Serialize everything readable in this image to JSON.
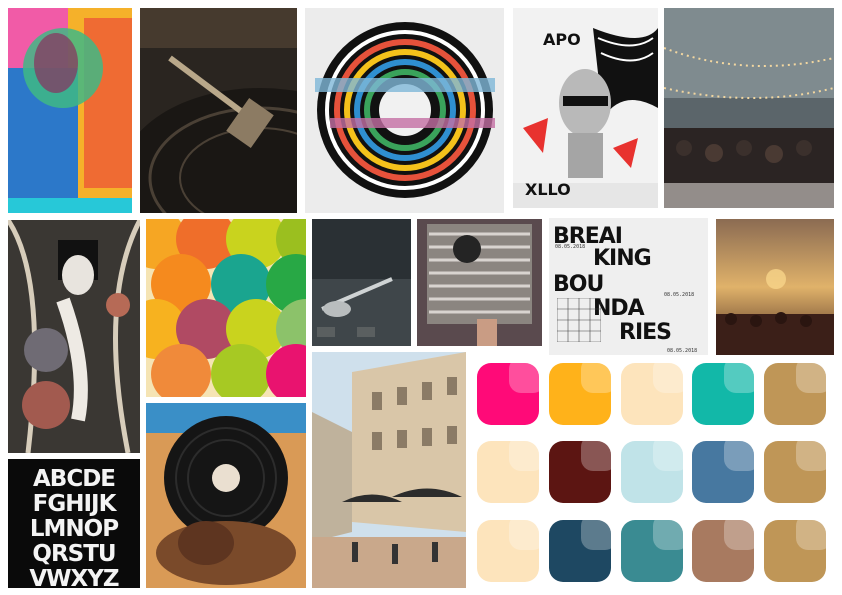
{
  "moodboard": {
    "alphabet_lines": [
      "ABCDE",
      "FGHIJK",
      "LMNOP",
      "QRSTU",
      "VWXYZ"
    ],
    "poster": {
      "line1": "BREAI",
      "line2": "KING",
      "line3": "BOU",
      "line4": "NDA",
      "line5": "RIES",
      "date": "08.05.2018"
    },
    "collage_text": [
      "APO",
      "XLLO"
    ],
    "palette": [
      "#ff0a78",
      "#ffb21a",
      "#fde4bc",
      "#12b8a8",
      "#bf9657",
      "#fde4bc",
      "#5c1512",
      "#c0e3e8",
      "#4778a0",
      "#bf9657",
      "#fde4bc",
      "#1e4862",
      "#3a8b92",
      "#a87a60",
      "#bf9657"
    ]
  }
}
